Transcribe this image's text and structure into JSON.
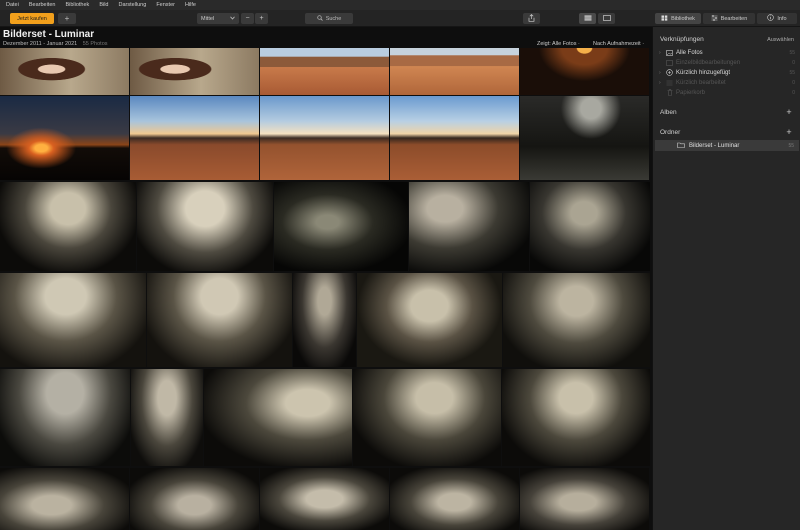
{
  "menu": [
    "Datei",
    "Bearbeiten",
    "Bibliothek",
    "Bild",
    "Darstellung",
    "Fenster",
    "Hilfe"
  ],
  "toolbar": {
    "buy_label": "Jetzt kaufen",
    "add_label": "+",
    "zoom_value": "Mittel",
    "zoom_minus": "−",
    "zoom_plus": "+",
    "search_label": "Suche",
    "tabs": {
      "library": "Bibliothek",
      "edit": "Bearbeiten",
      "info": "Info"
    }
  },
  "colors": {
    "accent": "#f2a01c",
    "background": "#0e0e0e",
    "panel": "#262626"
  },
  "gallery": {
    "title": "Bilderset - Luminar",
    "date_range": "Dezember 2011 - Januar 2021",
    "count": "55 Photos",
    "filter_label": "Zeigt:",
    "filter_value": "Alle Fotos ·",
    "sort_value": "Nach Aufnahmezeit ·"
  },
  "sidebar": {
    "shortcuts_title": "Verknüpfungen",
    "shortcuts_action": "Auswählen",
    "items": [
      {
        "label": "Alle Fotos",
        "count": "55",
        "icon": "photos-icon"
      },
      {
        "label": "Einzelbildbearbeitungen",
        "count": "0",
        "icon": "single-edit-icon"
      },
      {
        "label": "Kürzlich hinzugefügt",
        "count": "55",
        "icon": "recent-added-icon"
      },
      {
        "label": "Kürzlich bearbeitet",
        "count": "0",
        "icon": "recent-edited-icon"
      },
      {
        "label": "Papierkorb",
        "count": "0",
        "icon": "trash-icon"
      }
    ],
    "albums_title": "Alben",
    "folders_title": "Ordner",
    "folder": {
      "label": "Bilderset - Luminar",
      "count": "55"
    }
  }
}
